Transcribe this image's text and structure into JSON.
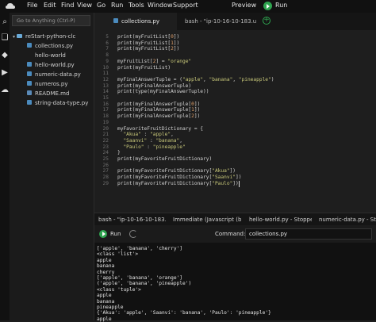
{
  "menubar": {
    "items": [
      "File",
      "Edit",
      "Find",
      "View",
      "Go",
      "Run",
      "Tools",
      "Window",
      "Support"
    ],
    "preview_label": "Preview",
    "run_label": "Run"
  },
  "sidebar": {
    "goto_placeholder": "Go to Anything (Ctrl-P)",
    "folder": "reStart-python-clc",
    "files": [
      {
        "name": "collections.py",
        "icon": "python-file-icon"
      },
      {
        "name": "hello-world",
        "icon": "file-icon"
      },
      {
        "name": "hello-world.py",
        "icon": "python-file-icon"
      },
      {
        "name": "numeric-data.py",
        "icon": "python-file-icon"
      },
      {
        "name": "numeros.py",
        "icon": "python-file-icon"
      },
      {
        "name": "README.md",
        "icon": "markdown-file-icon"
      },
      {
        "name": "string-data-type.py",
        "icon": "python-file-icon"
      }
    ]
  },
  "editor": {
    "tabs": [
      {
        "label": "collections.py",
        "active": true
      },
      {
        "label": "bash - \"ip-10-16-10-183.u",
        "active": false
      }
    ],
    "line_numbers": [
      "5",
      "6",
      "7",
      "8",
      "9",
      "10",
      "11",
      "12",
      "13",
      "14",
      "15",
      "16",
      "17",
      "18",
      "19",
      "20",
      "21",
      "22",
      "23",
      "24",
      "25",
      "26",
      "27",
      "28",
      "29"
    ],
    "code_lines": [
      "print(myFruitList[0])",
      "print(myFruitList[1])",
      "print(myFruitList[2])",
      "",
      "myFruitList[2] = \"orange\"",
      "print(myFruitList)",
      "",
      "myFinalAnswerTuple = (\"apple\", \"banana\", \"pineapple\")",
      "print(myFinalAnswerTuple)",
      "print(type(myFinalAnswerTuple))",
      "",
      "print(myFinalAnswerTuple[0])",
      "print(myFinalAnswerTuple[1])",
      "print(myFinalAnswerTuple[2])",
      "",
      "myFavoriteFruitDictionary = {",
      "  \"Akua\" : \"apple\",",
      "  \"Saanvi\" : \"banana\",",
      "  \"Paulo\" : \"pineapple\"",
      "}",
      "print(myFavoriteFruitDictionary)",
      "",
      "print(myFavoriteFruitDictionary[\"Akua\"])",
      "print(myFavoriteFruitDictionary[\"Saanvi\"])",
      "print(myFavoriteFruitDictionary[\"Paulo\"])"
    ]
  },
  "bottom_panel": {
    "tabs": [
      {
        "label": "bash - \"ip-10-16-10-183.u",
        "active": false
      },
      {
        "label": "Immediate (Javascript (br",
        "active": false
      },
      {
        "label": "hello-world.py - Stopped",
        "active": false
      },
      {
        "label": "numeric-data.py - Stoppe",
        "active": false
      }
    ],
    "run_label": "Run",
    "command_label": "Command:",
    "command_value": "collections.py",
    "output_lines": [
      "['apple', 'banana', 'cherry']",
      "<class 'list'>",
      "apple",
      "banana",
      "cherry",
      "['apple', 'banana', 'orange']",
      "('apple', 'banana', 'pineapple')",
      "<class 'tuple'>",
      "apple",
      "banana",
      "pineapple",
      "{'Akua': 'apple', 'Saanvi': 'banana', 'Paulo': 'pineapple'}",
      "apple"
    ]
  },
  "colors": {
    "accent_green": "#2ea44f",
    "editor_bg": "#1e1e1e",
    "string": "#c9c97a"
  }
}
